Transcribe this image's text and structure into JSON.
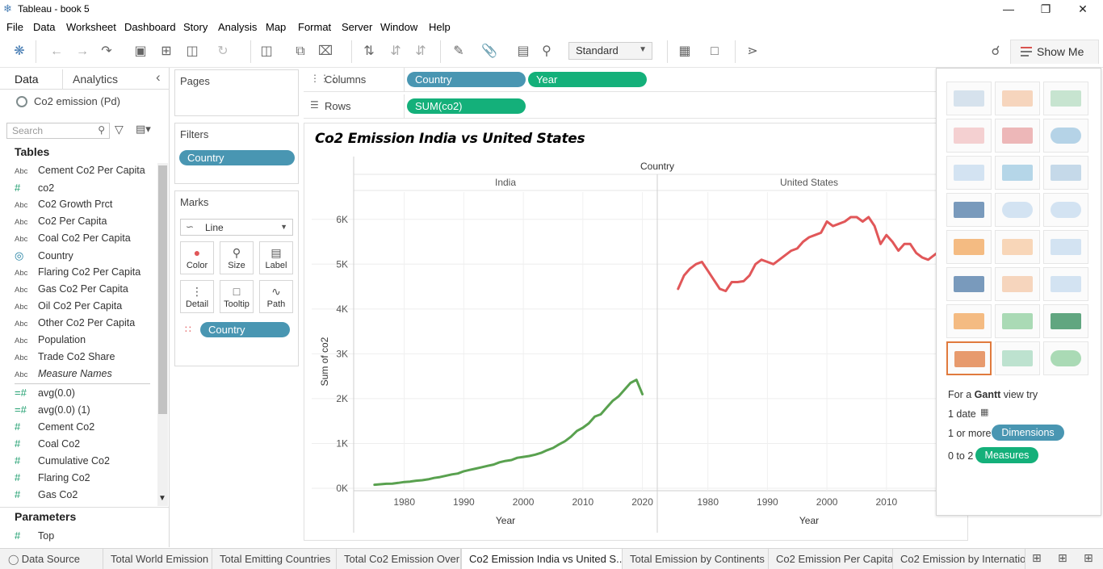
{
  "window": {
    "title": "Tableau - book 5",
    "minimize": "—",
    "restore": "❐",
    "close": "✕"
  },
  "menu": [
    "File",
    "Data",
    "Worksheet",
    "Dashboard",
    "Story",
    "Analysis",
    "Map",
    "Format",
    "Server",
    "Window",
    "Help"
  ],
  "toolbar": {
    "fit_value": "Standard",
    "show_me_label": "Show Me"
  },
  "data_pane": {
    "tab_data": "Data",
    "tab_analytics": "Analytics",
    "collapse": "‹",
    "datasource": "Co2  emission (Pd)",
    "search_placeholder": "Search",
    "tables_title": "Tables",
    "fields": [
      {
        "type": "Abc",
        "name": "Cement Co2 Per Capita"
      },
      {
        "type": "#",
        "name": "co2"
      },
      {
        "type": "Abc",
        "name": "Co2 Growth Prct"
      },
      {
        "type": "Abc",
        "name": "Co2 Per Capita"
      },
      {
        "type": "Abc",
        "name": "Coal Co2 Per Capita"
      },
      {
        "type": "globe",
        "name": "Country"
      },
      {
        "type": "Abc",
        "name": "Flaring Co2 Per Capita"
      },
      {
        "type": "Abc",
        "name": "Gas Co2 Per Capita"
      },
      {
        "type": "Abc",
        "name": "Oil Co2 Per Capita"
      },
      {
        "type": "Abc",
        "name": "Other Co2 Per Capita"
      },
      {
        "type": "Abc",
        "name": "Population"
      },
      {
        "type": "Abc",
        "name": "Trade Co2 Share"
      },
      {
        "type": "Abc",
        "name": "Measure Names"
      }
    ],
    "measures": [
      {
        "type": "calc#",
        "name": "avg(0.0)"
      },
      {
        "type": "calc#",
        "name": "avg(0.0) (1)"
      },
      {
        "type": "#",
        "name": "Cement Co2"
      },
      {
        "type": "#",
        "name": "Coal Co2"
      },
      {
        "type": "#",
        "name": "Cumulative Co2"
      },
      {
        "type": "#",
        "name": "Flaring Co2"
      },
      {
        "type": "#",
        "name": "Gas Co2"
      }
    ],
    "parameters_title": "Parameters",
    "parameters": [
      {
        "type": "#",
        "name": "Top"
      }
    ]
  },
  "cards": {
    "pages": "Pages",
    "filters": "Filters",
    "filter_pill": "Country",
    "marks": "Marks",
    "mark_type": "Line",
    "mark_buttons": [
      "Color",
      "Size",
      "Label",
      "Detail",
      "Tooltip",
      "Path"
    ],
    "marks_pill": "Country"
  },
  "shelves": {
    "columns_label": "Columns",
    "rows_label": "Rows",
    "columns_pills": [
      "Country",
      "Year"
    ],
    "rows_pills": [
      "SUM(co2)"
    ]
  },
  "viz": {
    "title": "Co2 Emission India vs United States",
    "header_title": "Country",
    "panes": [
      "India",
      "United States"
    ],
    "y_axis_title": "Sum of co2",
    "x_axis_title": "Year"
  },
  "chart_data": {
    "type": "line",
    "title": "Co2 Emission India vs United States",
    "xlabel": "Year",
    "ylabel": "Sum of co2",
    "ylim": [
      0,
      6500
    ],
    "yticks": [
      "0K",
      "1K",
      "2K",
      "3K",
      "4K",
      "5K",
      "6K"
    ],
    "grid": true,
    "facets": [
      {
        "name": "India",
        "color": "#59a14f",
        "xticks": [
          "1980",
          "1990",
          "2000",
          "2010",
          "2020"
        ],
        "x": [
          1975,
          1976,
          1977,
          1978,
          1979,
          1980,
          1981,
          1982,
          1983,
          1984,
          1985,
          1986,
          1987,
          1988,
          1989,
          1990,
          1991,
          1992,
          1993,
          1994,
          1995,
          1996,
          1997,
          1998,
          1999,
          2000,
          2001,
          2002,
          2003,
          2004,
          2005,
          2006,
          2007,
          2008,
          2009,
          2010,
          2011,
          2012,
          2013,
          2014,
          2015,
          2016,
          2017,
          2018,
          2019,
          2020
        ],
        "values": [
          80,
          90,
          100,
          105,
          120,
          140,
          150,
          170,
          180,
          200,
          230,
          250,
          280,
          310,
          330,
          380,
          410,
          440,
          470,
          500,
          530,
          580,
          610,
          630,
          680,
          700,
          720,
          750,
          790,
          850,
          900,
          980,
          1050,
          1150,
          1280,
          1350,
          1450,
          1600,
          1650,
          1800,
          1950,
          2050,
          2200,
          2350,
          2420,
          2100
        ]
      },
      {
        "name": "United States",
        "color": "#e15759",
        "xticks": [
          "1980",
          "1990",
          "2000",
          "2010"
        ],
        "x": [
          1975,
          1976,
          1977,
          1978,
          1979,
          1980,
          1981,
          1982,
          1983,
          1984,
          1985,
          1986,
          1987,
          1988,
          1989,
          1990,
          1991,
          1992,
          1993,
          1994,
          1995,
          1996,
          1997,
          1998,
          1999,
          2000,
          2001,
          2002,
          2003,
          2004,
          2005,
          2006,
          2007,
          2008,
          2009,
          2010,
          2011,
          2012,
          2013,
          2014,
          2015,
          2016,
          2017,
          2018,
          2019
        ],
        "values": [
          4450,
          4750,
          4900,
          5000,
          5050,
          4850,
          4650,
          4450,
          4400,
          4600,
          4600,
          4620,
          4750,
          5000,
          5100,
          5050,
          5000,
          5100,
          5200,
          5300,
          5350,
          5500,
          5600,
          5650,
          5700,
          5950,
          5850,
          5900,
          5950,
          6050,
          6050,
          5950,
          6050,
          5850,
          5450,
          5650,
          5500,
          5300,
          5450,
          5450,
          5250,
          5150,
          5100,
          5200,
          5300
        ]
      }
    ]
  },
  "show_me": {
    "hint_prefix": "For a",
    "hint_type": "Gantt",
    "hint_suffix": "view try",
    "req1": "1 date",
    "req2": "1 or more",
    "req2_pill": "Dimensions",
    "req3": "0 to 2",
    "req3_pill": "Measures",
    "thumbnails": [
      "text-table",
      "highlight-table",
      "heat-map",
      "symbol-map",
      "filled-map",
      "pie-chart",
      "horizontal-bars",
      "stacked-bars",
      "side-by-side-bars",
      "treemap",
      "circle-views",
      "side-by-side-circles",
      "lines-discrete",
      "lines-continuous",
      "dual-lines",
      "area-discrete",
      "area-continuous",
      "dual-combination",
      "scatter-plot",
      "histogram",
      "box-and-whisker",
      "gantt-chart",
      "bullet-graph",
      "packed-bubbles"
    ]
  },
  "sheets": {
    "data_source": "Data Source",
    "tabs": [
      "Total World Emission",
      "Total Emitting Countries",
      "Total Co2 Emission Over",
      "Co2 Emission India vs United S...",
      "Total Emission by Continents",
      "Co2 Emission Per Capita",
      "Co2 Emission by Internation"
    ]
  },
  "colors": {
    "dimension_pill": "#4996b2",
    "measure_pill": "#14b07a",
    "india": "#59a14f",
    "united_states": "#e15759"
  }
}
